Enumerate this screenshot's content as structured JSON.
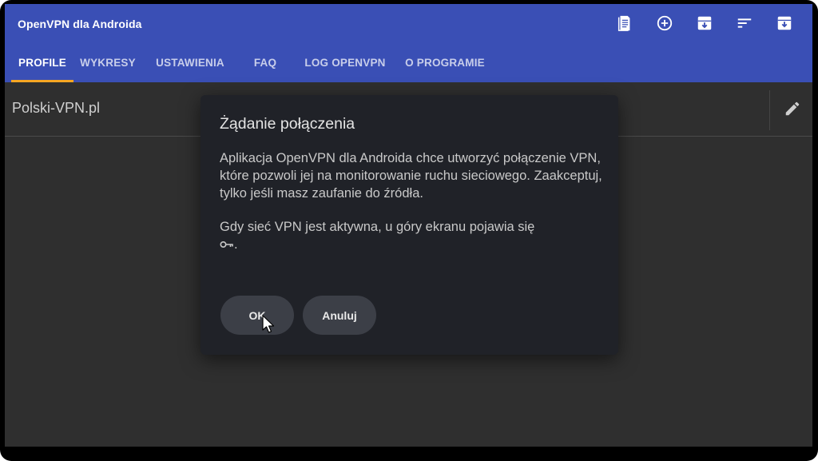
{
  "app": {
    "title": "OpenVPN dla Androida"
  },
  "toolbar": {
    "icons": [
      "import-file-icon",
      "add-circle-icon",
      "archive-icon",
      "sort-icon",
      "download-box-icon"
    ]
  },
  "tabs": [
    {
      "label": "PROFILE",
      "active": true
    },
    {
      "label": "WYKRESY",
      "active": false
    },
    {
      "label": "USTAWIENIA",
      "active": false
    },
    {
      "label": "FAQ",
      "active": false
    },
    {
      "label": "LOG OPENVPN",
      "active": false
    },
    {
      "label": "O PROGRAMIE",
      "active": false
    }
  ],
  "profiles": [
    {
      "name": "Polski-VPN.pl"
    }
  ],
  "dialog": {
    "title": "Żądanie połączenia",
    "paragraph1": "Aplikacja OpenVPN dla Androida chce utworzyć połączenie VPN, które pozwoli jej na monitorowanie ruchu sieciowego. Zaakceptuj, tylko jeśli masz zaufanie do źródła.",
    "paragraph2": "Gdy sieć VPN jest aktywna, u góry ekranu pojawia się",
    "paragraph2_end": ".",
    "ok_label": "OK",
    "cancel_label": "Anuluj"
  },
  "colors": {
    "appbar": "#3a4fb5",
    "tab_indicator": "#f5a623",
    "background": "#2f2f2f",
    "dialog": "#202228",
    "button": "#3c3f47"
  }
}
